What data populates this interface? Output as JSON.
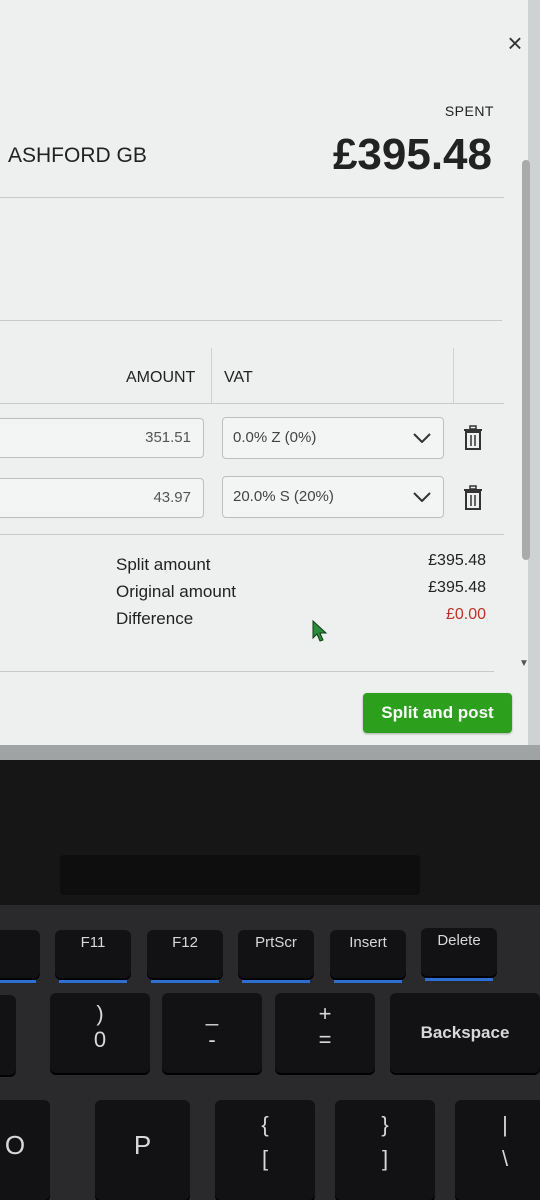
{
  "header": {
    "close_icon": "×",
    "spent_label": "SPENT",
    "merchant": "ASHFORD GB",
    "total": "£395.48"
  },
  "table": {
    "columns": [
      "AMOUNT",
      "VAT"
    ],
    "rows": [
      {
        "amount": "351.51",
        "vat": "0.0% Z (0%)"
      },
      {
        "amount": "43.97",
        "vat": "20.0% S (20%)"
      }
    ]
  },
  "summary": {
    "split_label": "Split amount",
    "split_value": "£395.48",
    "original_label": "Original amount",
    "original_value": "£395.48",
    "difference_label": "Difference",
    "difference_value": "£0.00"
  },
  "actions": {
    "split_and_post": "Split and post"
  },
  "colors": {
    "primary_button": "#2ca01c",
    "difference": "#c0302a"
  },
  "keyboard": {
    "fkeys": [
      "F11",
      "F12",
      "PrtScr",
      "Insert",
      "Delete"
    ],
    "row2": [
      ")",
      "0",
      "_",
      "-",
      "+",
      "=",
      "Backspace"
    ],
    "row3": [
      "O",
      "P",
      "{",
      "[",
      "}",
      "]",
      "|",
      "\\"
    ]
  }
}
